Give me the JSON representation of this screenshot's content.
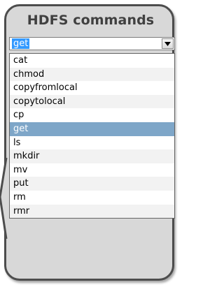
{
  "panel": {
    "title": "HDFS commands"
  },
  "combo": {
    "value": "get"
  },
  "dropdown": {
    "selected_index": 5,
    "items": [
      "cat",
      "chmod",
      "copyfromlocal",
      "copytolocal",
      "cp",
      "get",
      "ls",
      "mkdir",
      "mv",
      "put",
      "rm",
      "rmr"
    ]
  },
  "icons": {
    "dropdown_button": "triangle-down-icon"
  },
  "colors": {
    "panel_background": "#d8d8d8",
    "panel_border": "#4d4d4d",
    "selection_highlight": "#7ea6c8",
    "text_selection": "#3399ff"
  }
}
